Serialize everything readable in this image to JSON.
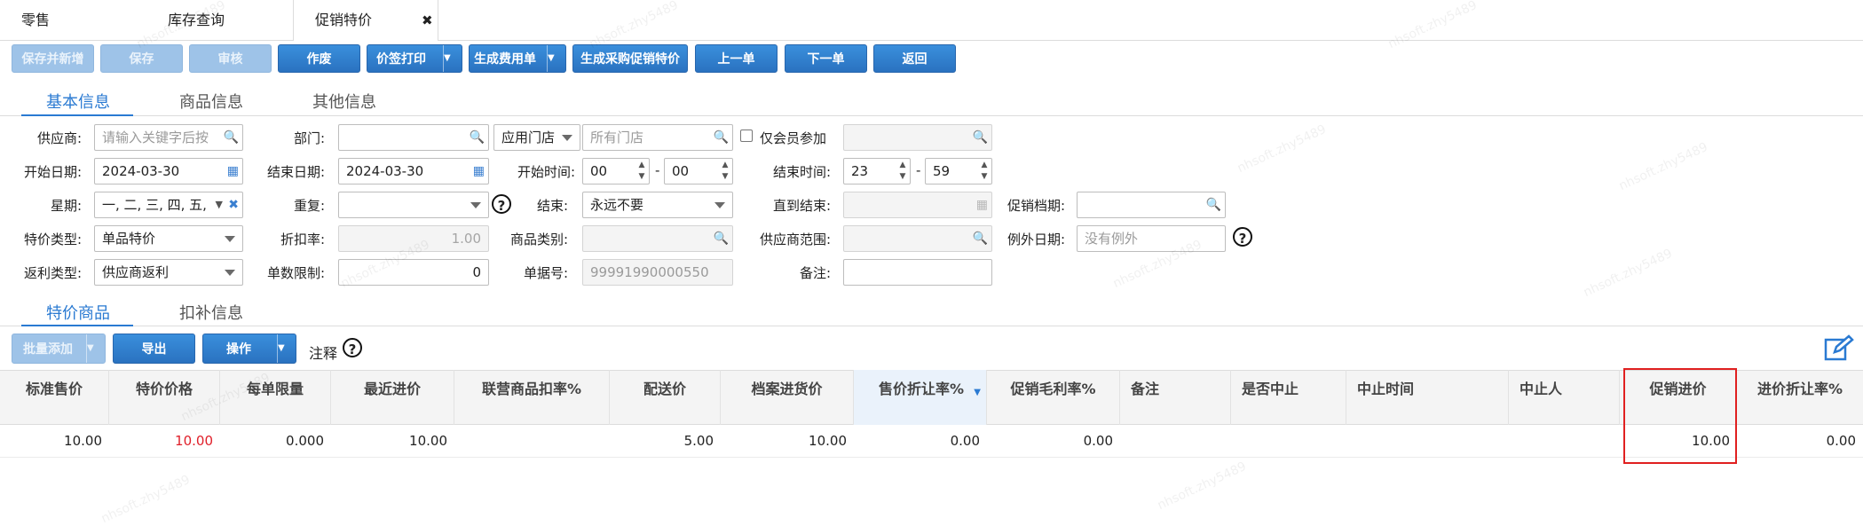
{
  "top_tabs": [
    "零售",
    "库存查询",
    "促销特价"
  ],
  "toolbar": {
    "save_new": "保存并新增",
    "save": "保存",
    "audit": "审核",
    "void": "作废",
    "price_print": "价签打印",
    "gen_fee": "生成费用单",
    "gen_purchase": "生成采购促销特价",
    "prev": "上一单",
    "next": "下一单",
    "back": "返回"
  },
  "section_tabs": [
    "基本信息",
    "商品信息",
    "其他信息"
  ],
  "form": {
    "supplier": {
      "label": "供应商:",
      "placeholder": "请输入关键字后按"
    },
    "dept": {
      "label": "部门:",
      "value": ""
    },
    "store_scope": {
      "select": "应用门店",
      "placeholder": "所有门店"
    },
    "member_only": {
      "label": "仅会员参加"
    },
    "start_date": {
      "label": "开始日期:",
      "value": "2024-03-30"
    },
    "end_date": {
      "label": "结束日期:",
      "value": "2024-03-30"
    },
    "start_time": {
      "label": "开始时间:",
      "hour": "00",
      "minute": "00",
      "sep": "-"
    },
    "end_time": {
      "label": "结束时间:",
      "hour": "23",
      "minute": "59",
      "sep": "-"
    },
    "weekday": {
      "label": "星期:",
      "value": "一, 二, 三, 四, 五,"
    },
    "repeat": {
      "label": "重复:",
      "value": ""
    },
    "end": {
      "label": "结束:",
      "value": "永远不要"
    },
    "until_end": {
      "label": "直到结束:"
    },
    "promo_file": {
      "label": "促销档期:"
    },
    "special_type": {
      "label": "特价类型:",
      "value": "单品特价"
    },
    "discount_rate": {
      "label": "折扣率:",
      "value": "1.00"
    },
    "goods_category": {
      "label": "商品类别:"
    },
    "supplier_range": {
      "label": "供应商范围:"
    },
    "exception_date": {
      "label": "例外日期:",
      "placeholder": "没有例外"
    },
    "rebate_type": {
      "label": "返利类型:",
      "value": "供应商返利"
    },
    "count_limit": {
      "label": "单数限制:",
      "value": "0"
    },
    "doc_no": {
      "label": "单据号:",
      "value": "99991990000550"
    },
    "remark": {
      "label": "备注:",
      "value": ""
    }
  },
  "goods_tabs": [
    "特价商品",
    "扣补信息"
  ],
  "table_toolbar": {
    "batch_add": "批量添加",
    "export": "导出",
    "operate": "操作",
    "note": "注释"
  },
  "table": {
    "columns": [
      "标准售价",
      "特价价格",
      "每单限量",
      "最近进价",
      "联营商品扣率%",
      "配送价",
      "档案进货价",
      "售价折让率%",
      "促销毛利率%",
      "备注",
      "是否中止",
      "中止时间",
      "中止人",
      "促销进价",
      "进价折让率%"
    ],
    "rows": [
      [
        "10.00",
        "10.00",
        "0.000",
        "10.00",
        "",
        "5.00",
        "10.00",
        "0.00",
        "0.00",
        "",
        "",
        "",
        "",
        "10.00",
        "0.00"
      ]
    ]
  },
  "colors": {
    "accent": "#2a7ad2",
    "special_price": "#e0202a",
    "highlight_box": "#e02020"
  },
  "watermark": "nhsoft.zhy5489"
}
